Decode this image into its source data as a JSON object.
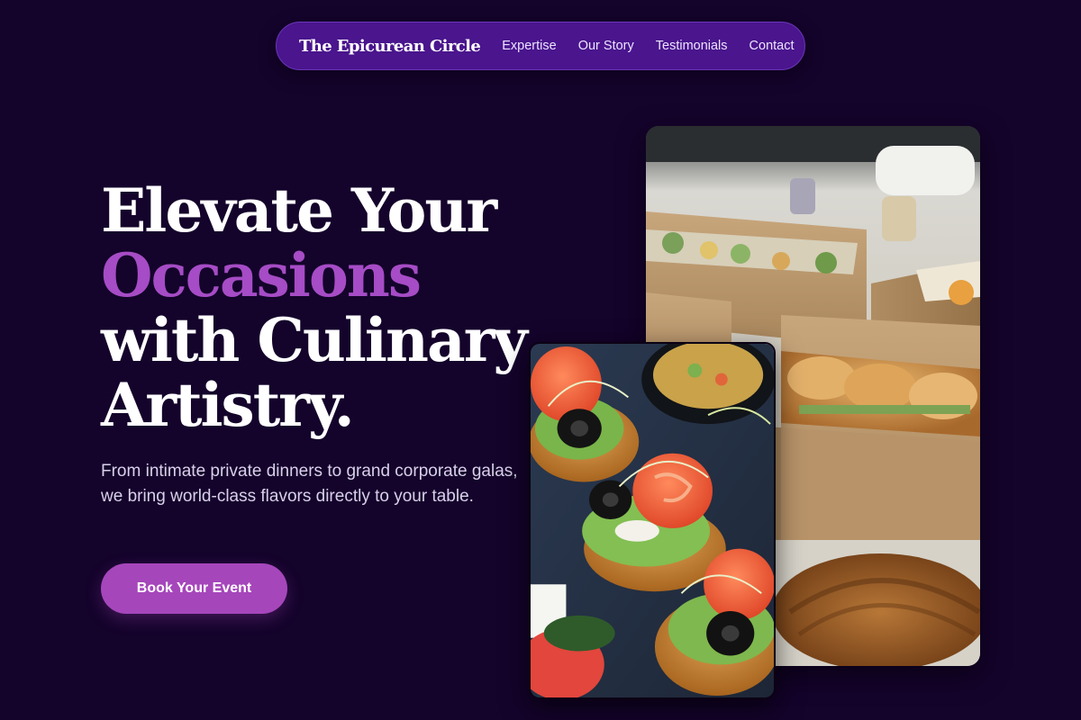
{
  "nav": {
    "brand": "The Epicurean Circle",
    "links": [
      "Expertise",
      "Our Story",
      "Testimonials",
      "Contact"
    ]
  },
  "hero": {
    "title_line1": "Elevate Your",
    "title_accent": "Occasions",
    "title_line3": "with Culinary",
    "title_line4": "Artistry.",
    "subtitle": "From intimate private dinners to grand corporate galas, we bring world-class flavors directly to your table.",
    "cta_label": "Book Your Event"
  },
  "images": {
    "back": "catering-boxes-photo",
    "front": "canape-platter-photo"
  },
  "colors": {
    "background": "#14032b",
    "nav_bg": "#4a158d",
    "accent": "#a64cc6",
    "cta": "#a646bb"
  }
}
